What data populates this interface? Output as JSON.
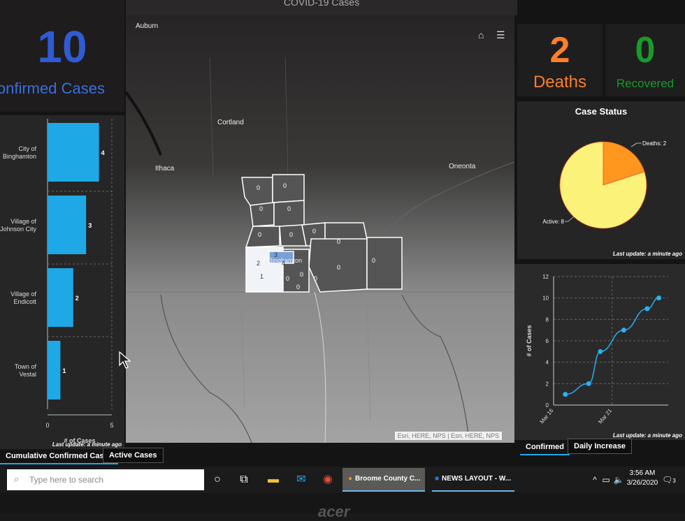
{
  "dashboard": {
    "title_fragment": "COVID-19 Cases",
    "confirmed": {
      "value": "10",
      "label": "Confirmed Cases",
      "color": "#2f5bd3"
    },
    "deaths": {
      "value": "2",
      "label": "Deaths",
      "color": "#ff7f2a"
    },
    "recovered": {
      "value": "0",
      "label": "Recovered",
      "color": "#1a9a2a"
    },
    "last_update": "Last update: a minute ago"
  },
  "left_tabs": [
    "Cumulative Confirmed Cases",
    "Active Cases"
  ],
  "right_tabs": [
    "Confirmed",
    "Daily Increase"
  ],
  "map": {
    "labels": [
      "Auburn",
      "Cortland",
      "Ithaca",
      "Oneonta",
      "Binghamton"
    ],
    "attribution": "Esri, HERE, NPS | Esri, HERE, NPS",
    "home_icon": "home-icon",
    "list_icon": "list-icon",
    "region_counts": [
      "0",
      "0",
      "0",
      "0",
      "0",
      "0",
      "0",
      "0",
      "0",
      "0",
      "0",
      "0",
      "0",
      "0",
      "0",
      "3",
      "2",
      "1",
      "4"
    ]
  },
  "chart_data": [
    {
      "type": "bar",
      "orientation": "horizontal",
      "categories": [
        "City of Binghamton",
        "Village of Johnson City",
        "Village of Endicott",
        "Town of Vestal"
      ],
      "values": [
        4,
        3,
        2,
        1
      ],
      "xlabel": "# of Cases",
      "xlim": [
        0,
        5
      ],
      "xticks": [
        "0",
        "5"
      ],
      "color": "#1fa8e6",
      "grid": true
    },
    {
      "type": "pie",
      "title": "Case Status",
      "slices": [
        {
          "label": "Deaths: 2",
          "name": "Deaths",
          "value": 2,
          "color": "#ff961e"
        },
        {
          "label": "Active: 8",
          "name": "Active",
          "value": 8,
          "color": "#fbf27a"
        }
      ]
    },
    {
      "type": "line",
      "x": [
        "Mar 17",
        "Mar 19",
        "Mar 20",
        "Mar 22",
        "Mar 24",
        "Mar 25"
      ],
      "x_day": [
        17,
        19,
        20,
        22,
        24,
        25
      ],
      "values": [
        1,
        2,
        5,
        7,
        9,
        10
      ],
      "ylabel": "# of Cases",
      "ylim": [
        0,
        12
      ],
      "yticks": [
        "0",
        "2",
        "4",
        "6",
        "8",
        "10",
        "12"
      ],
      "xticks": [
        "Mar 16",
        "Mar 21"
      ],
      "xtick_days": [
        16,
        21
      ],
      "xlim_days": [
        16,
        25.8
      ],
      "color": "#2aa6e8",
      "grid": true
    }
  ],
  "taskbar": {
    "search_placeholder": "Type here to search",
    "apps": [
      "Broome County C...",
      "NEWS LAYOUT - W..."
    ],
    "time": "3:56 AM",
    "date": "3/26/2020",
    "notification_count": "3"
  }
}
